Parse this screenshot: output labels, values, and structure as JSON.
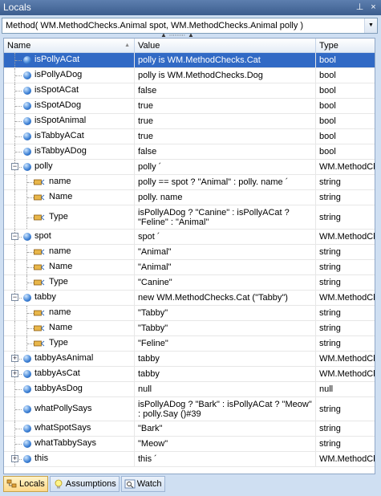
{
  "window": {
    "title": "Locals",
    "pin_glyph": "⊥",
    "close_glyph": "×"
  },
  "combo": {
    "value": "Method( WM.MethodChecks.Animal spot, WM.MethodChecks.Animal polly )",
    "arrow": "▼"
  },
  "columns": {
    "name": "Name",
    "value": "Value",
    "type": "Type",
    "sort_glyph": "▲"
  },
  "rows": [
    {
      "name": "isPollyACat",
      "value": "polly is WM.MethodChecks.Cat",
      "type": "bool",
      "selected": true,
      "icon": "variable-icon"
    },
    {
      "name": "isPollyADog",
      "value": "polly is WM.MethodChecks.Dog",
      "type": "bool",
      "icon": "variable-icon"
    },
    {
      "name": "isSpotACat",
      "value": "false",
      "type": "bool",
      "icon": "variable-icon"
    },
    {
      "name": "isSpotADog",
      "value": "true",
      "type": "bool",
      "icon": "variable-icon"
    },
    {
      "name": "isSpotAnimal",
      "value": "true",
      "type": "bool",
      "icon": "variable-icon"
    },
    {
      "name": "isTabbyACat",
      "value": "true",
      "type": "bool",
      "icon": "variable-icon"
    },
    {
      "name": "isTabbyADog",
      "value": "false",
      "type": "bool",
      "icon": "variable-icon"
    },
    {
      "name": "polly",
      "value": "polly ´",
      "type": "WM.MethodCh",
      "expander": "⊟",
      "icon": "variable-icon"
    },
    {
      "name": "name",
      "value": "polly == spot ? \"Animal\" : polly. name ´",
      "type": "string",
      "child": true,
      "icon": "property-icon"
    },
    {
      "name": "Name",
      "value": "polly. name",
      "type": "string",
      "child": true,
      "icon": "property-icon"
    },
    {
      "name": "Type",
      "value": "isPollyADog ? \"Canine\" : isPollyACat ? \"Feline\" : \"Animal\"",
      "type": "string",
      "child": true,
      "icon": "property-icon",
      "tall": true
    },
    {
      "name": "spot",
      "value": "spot ´",
      "type": "WM.MethodCh",
      "expander": "⊟",
      "icon": "variable-icon"
    },
    {
      "name": "name",
      "value": "\"Animal\"",
      "type": "string",
      "child": true,
      "icon": "property-icon"
    },
    {
      "name": "Name",
      "value": "\"Animal\"",
      "type": "string",
      "child": true,
      "icon": "property-icon"
    },
    {
      "name": "Type",
      "value": "\"Canine\"",
      "type": "string",
      "child": true,
      "icon": "property-icon"
    },
    {
      "name": "tabby",
      "value": "new WM.MethodChecks.Cat (\"Tabby\")",
      "type": "WM.MethodCh",
      "expander": "⊟",
      "icon": "variable-icon"
    },
    {
      "name": "name",
      "value": "\"Tabby\"",
      "type": "string",
      "child": true,
      "icon": "property-icon"
    },
    {
      "name": "Name",
      "value": "\"Tabby\"",
      "type": "string",
      "child": true,
      "icon": "property-icon"
    },
    {
      "name": "Type",
      "value": "\"Feline\"",
      "type": "string",
      "child": true,
      "icon": "property-icon"
    },
    {
      "name": "tabbyAsAnimal",
      "value": "tabby",
      "type": "WM.MethodCh",
      "expander": "⊞",
      "icon": "variable-icon"
    },
    {
      "name": "tabbyAsCat",
      "value": "tabby",
      "type": "WM.MethodCh",
      "expander": "⊞",
      "icon": "variable-icon"
    },
    {
      "name": "tabbyAsDog",
      "value": "null",
      "type": "null",
      "icon": "variable-icon"
    },
    {
      "name": "whatPollySays",
      "value": "isPollyADog ? \"Bark\" : isPollyACat ? \"Meow\" : polly.Say ()#39",
      "type": "string",
      "icon": "variable-icon",
      "tall": true
    },
    {
      "name": "whatSpotSays",
      "value": "\"Bark\"",
      "type": "string",
      "icon": "variable-icon"
    },
    {
      "name": "whatTabbySays",
      "value": "\"Meow\"",
      "type": "string",
      "icon": "variable-icon"
    },
    {
      "name": "this",
      "value": "this ´",
      "type": "WM.MethodCh",
      "expander": "⊞",
      "icon": "variable-icon"
    }
  ],
  "tabs": [
    {
      "label": "Locals",
      "icon": "locals-icon",
      "active": true
    },
    {
      "label": "Assumptions",
      "icon": "lightbulb-icon"
    },
    {
      "label": "Watch",
      "icon": "watch-icon"
    }
  ],
  "colors": {
    "selection": "#316ac5",
    "title_bar": "#4a6c9e",
    "panel_bg": "#cfdff2"
  }
}
